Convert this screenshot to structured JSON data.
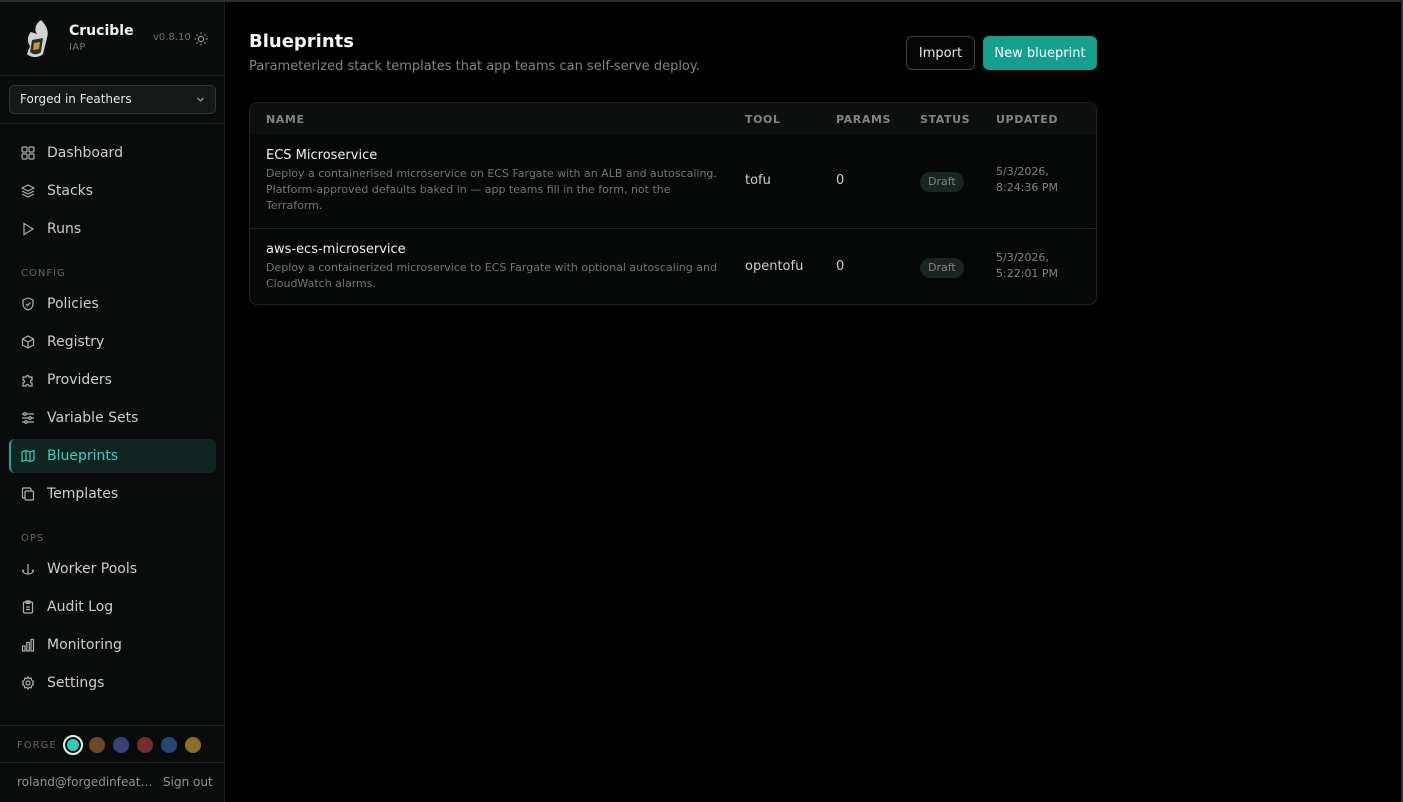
{
  "app": {
    "name": "Crucible",
    "subtitle": "IAP",
    "version": "v0.8.10"
  },
  "org": {
    "selected": "Forged in Feathers"
  },
  "nav": {
    "main": [
      {
        "label": "Dashboard",
        "icon": "grid-icon"
      },
      {
        "label": "Stacks",
        "icon": "layers-icon"
      },
      {
        "label": "Runs",
        "icon": "play-icon"
      }
    ],
    "config_label": "CONFIG",
    "config": [
      {
        "label": "Policies",
        "icon": "shield-check-icon"
      },
      {
        "label": "Registry",
        "icon": "box-icon"
      },
      {
        "label": "Providers",
        "icon": "puzzle-icon"
      },
      {
        "label": "Variable Sets",
        "icon": "sliders-icon"
      },
      {
        "label": "Blueprints",
        "icon": "map-icon",
        "active": true
      },
      {
        "label": "Templates",
        "icon": "copy-icon"
      }
    ],
    "ops_label": "OPS",
    "ops": [
      {
        "label": "Worker Pools",
        "icon": "anchor-icon"
      },
      {
        "label": "Audit Log",
        "icon": "clipboard-icon"
      },
      {
        "label": "Monitoring",
        "icon": "bar-chart-icon"
      },
      {
        "label": "Settings",
        "icon": "gear-icon"
      }
    ]
  },
  "forge": {
    "label": "FORGE",
    "swatches": [
      "#2fcdb8",
      "#6b4a25",
      "#3b3f7a",
      "#7a2a2a",
      "#24477a",
      "#8a6f2a"
    ],
    "selected_index": 0
  },
  "user": {
    "email": "roland@forgedinfeathers.com",
    "signout": "Sign out"
  },
  "page": {
    "title": "Blueprints",
    "subtitle": "Parameterized stack templates that app teams can self-serve deploy.",
    "import_label": "Import",
    "new_label": "New blueprint"
  },
  "table": {
    "columns": [
      "NAME",
      "TOOL",
      "PARAMS",
      "STATUS",
      "UPDATED"
    ],
    "rows": [
      {
        "name": "ECS Microservice",
        "description": "Deploy a containerised microservice on ECS Fargate with an ALB and autoscaling. Platform-approved defaults baked in — app teams fill in the form, not the Terraform.",
        "tool": "tofu",
        "params": "0",
        "status": "Draft",
        "updated": "5/3/2026, 8:24:36 PM"
      },
      {
        "name": "aws-ecs-microservice",
        "description": "Deploy a containerized microservice to ECS Fargate with optional autoscaling and CloudWatch alarms.",
        "tool": "opentofu",
        "params": "0",
        "status": "Draft",
        "updated": "5/3/2026, 5:22:01 PM"
      }
    ]
  }
}
